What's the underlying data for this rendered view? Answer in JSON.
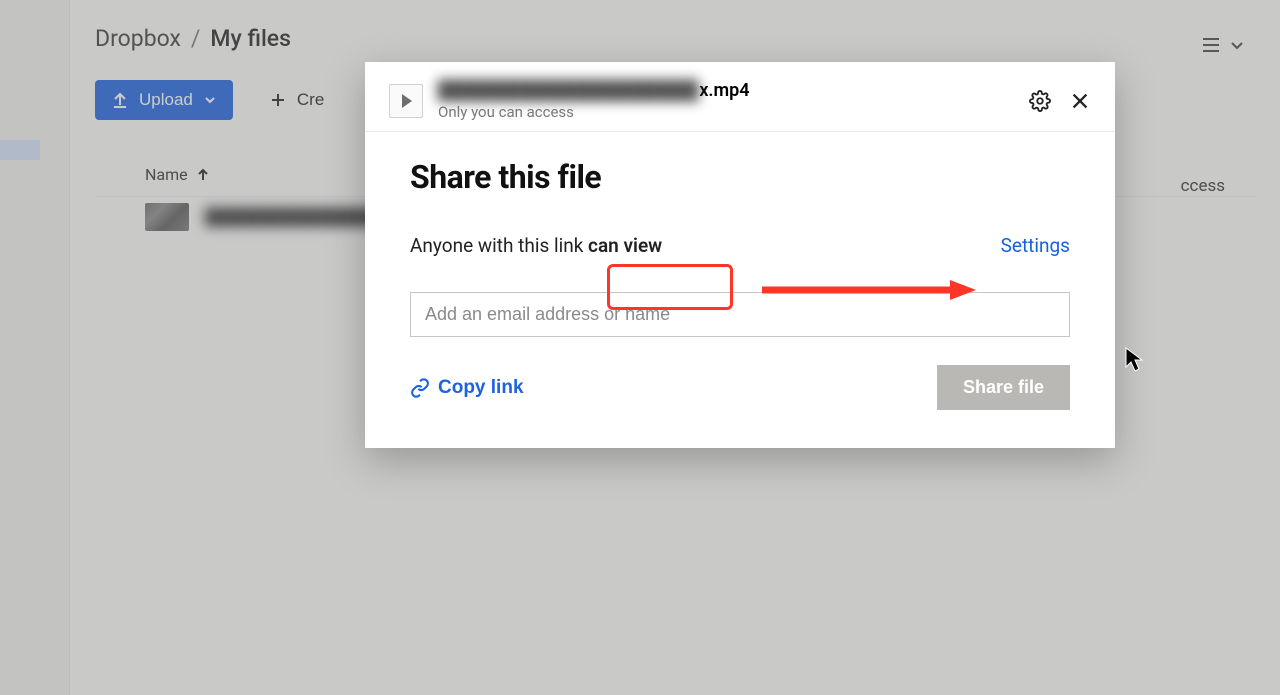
{
  "breadcrumb": {
    "root": "Dropbox",
    "sep": "/",
    "current": "My files"
  },
  "toolbar": {
    "upload_label": "Upload",
    "create_label_trunc": "Cre"
  },
  "table": {
    "name_header": "Name",
    "access_header_partial": "ccess",
    "rows": [
      {
        "name_blurred": "████████████████████"
      }
    ]
  },
  "modal": {
    "filename_prefix_blurred": "███████████████████",
    "filename_suffix": "x.mp4",
    "access_sub": "Only you can access",
    "heading": "Share this file",
    "perm_prefix": "Anyone with this link ",
    "perm_level": "can view",
    "settings_label": "Settings",
    "email_placeholder": "Add an email address or name",
    "copy_link_label": "Copy link",
    "share_file_label": "Share file"
  }
}
